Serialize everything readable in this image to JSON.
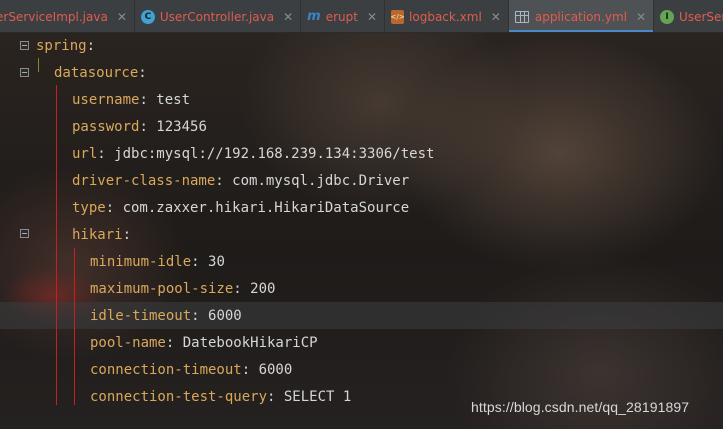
{
  "tabs": [
    {
      "label": "erServiceImpl.java",
      "icon": "class-icon",
      "active": false
    },
    {
      "label": "UserController.java",
      "icon": "class-icon",
      "active": false
    },
    {
      "label": "erupt",
      "icon": "module-icon",
      "active": false
    },
    {
      "label": "logback.xml",
      "icon": "xml-file-icon",
      "active": false
    },
    {
      "label": "application.yml",
      "icon": "yaml-file-icon",
      "active": true
    },
    {
      "label": "UserService.java",
      "icon": "interface-icon",
      "active": false
    }
  ],
  "editor": {
    "lines": [
      {
        "key": "spring",
        "value": ""
      },
      {
        "key": "datasource",
        "value": ""
      },
      {
        "key": "username",
        "value": "test"
      },
      {
        "key": "password",
        "value": "123456"
      },
      {
        "key": "url",
        "value": "jdbc:mysql://192.168.239.134:3306/test"
      },
      {
        "key": "driver-class-name",
        "value": "com.mysql.jdbc.Driver"
      },
      {
        "key": "type",
        "value": "com.zaxxer.hikari.HikariDataSource"
      },
      {
        "key": "hikari",
        "value": ""
      },
      {
        "key": "minimum-idle",
        "value": "30"
      },
      {
        "key": "maximum-pool-size",
        "value": "200"
      },
      {
        "key": "idle-timeout",
        "value": "6000"
      },
      {
        "key": "pool-name",
        "value": "DatebookHikariCP"
      },
      {
        "key": "connection-timeout",
        "value": "6000"
      },
      {
        "key": "connection-test-query",
        "value": "SELECT 1"
      }
    ],
    "highlighted_line": 10
  },
  "watermark": "https://blog.csdn.net/qq_28191897",
  "colors": {
    "key": "#d9a85b",
    "value": "#d6d6d6",
    "indent_guide": "#c8201f",
    "active_tab_underline": "#4a88c7"
  }
}
